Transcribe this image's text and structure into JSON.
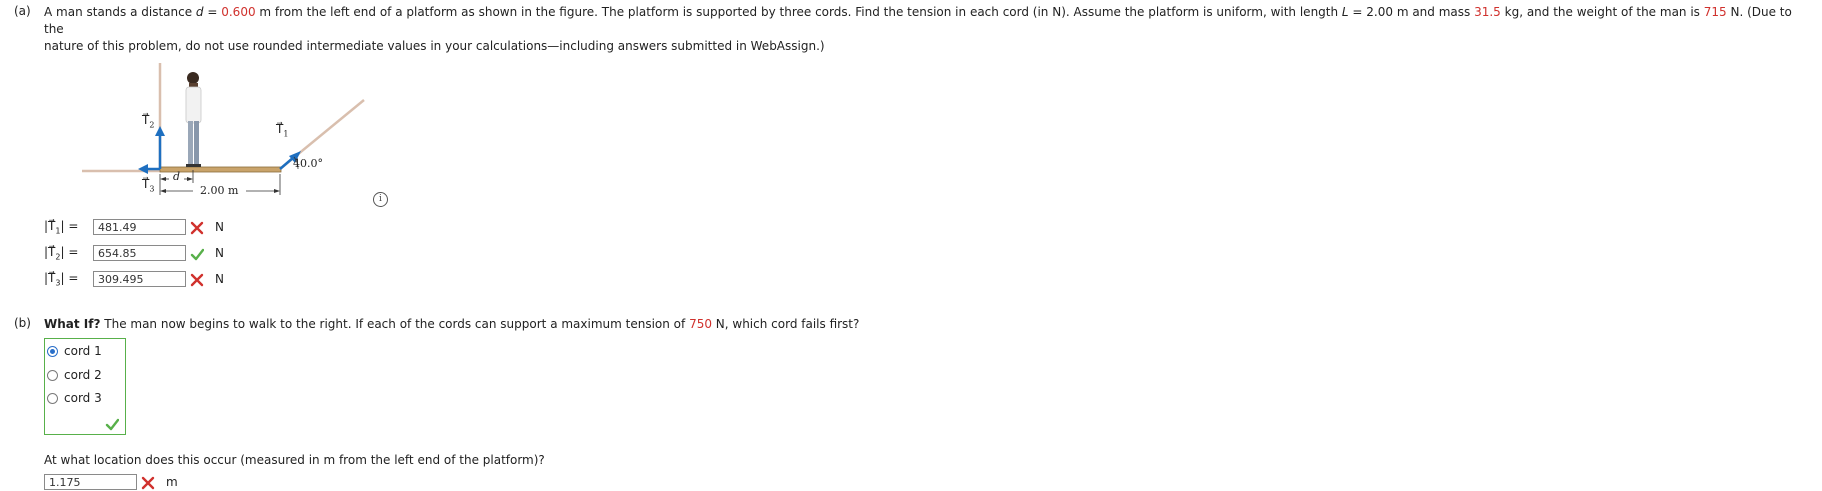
{
  "part_a": {
    "label": "(a)",
    "q_line1_pre": "A man stands a distance ",
    "q_d_var": "d",
    "q_eq1": " = ",
    "q_d_value": "0.600",
    "q_line1_mid": " m from the left end of a platform as shown in the figure. The platform is supported by three cords. Find the tension in each cord (in N). Assume the platform is uniform, with length ",
    "q_L_var": "L",
    "q_eq2": " = 2.00 m and mass ",
    "q_mass": "31.5",
    "q_line1_mid2": " kg, and the weight of the man is ",
    "q_weight": "715",
    "q_line1_end": " N. (Due to the",
    "q_line2": "nature of this problem, do not use rounded intermediate values in your calculations—including answers submitted in WebAssign.)",
    "figure": {
      "t2_label": "T⃗",
      "t2_sub": "2",
      "t1_label": "T⃗",
      "t1_sub": "1",
      "t3_label": "T⃗",
      "t3_sub": "3",
      "d_label": "d",
      "length_label": "2.00 m",
      "angle_label": "40.0°"
    },
    "info_icon": "i",
    "answers": [
      {
        "label_pre": "|T⃗",
        "sub": "1",
        "label_post": "|  =",
        "value": "481.49",
        "status": "incorrect",
        "unit": "N"
      },
      {
        "label_pre": "|T⃗",
        "sub": "2",
        "label_post": "|  =",
        "value": "654.85",
        "status": "correct",
        "unit": "N"
      },
      {
        "label_pre": "|T⃗",
        "sub": "3",
        "label_post": "|  =",
        "value": "309.495",
        "status": "incorrect",
        "unit": "N"
      }
    ]
  },
  "part_b": {
    "label": "(b)",
    "q_bold": "What If?",
    "q_pre": " The man now begins to walk to the right. If each of the cords can support a maximum tension of ",
    "q_max": "750",
    "q_post": " N, which cord fails first?",
    "options": [
      {
        "label": "cord 1",
        "selected": true
      },
      {
        "label": "cord 2",
        "selected": false
      },
      {
        "label": "cord 3",
        "selected": false
      }
    ],
    "choice_status": "correct",
    "q2": "At what location does this occur (measured in m from the left end of the platform)?",
    "answer_value": "1.175",
    "answer_status": "incorrect",
    "answer_unit": "m"
  },
  "colors": {
    "accent_red": "#d0312d",
    "correct_green": "#58b04a",
    "arrow_blue": "#1e6fc0",
    "cord_tan": "#d9bfae"
  }
}
